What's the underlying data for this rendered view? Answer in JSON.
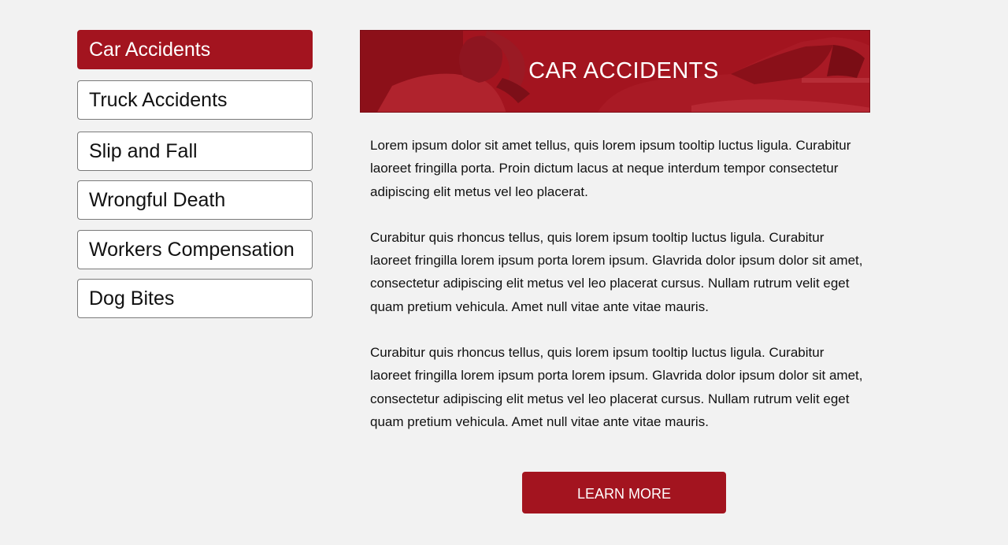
{
  "sidebar": {
    "items": [
      {
        "label": "Car Accidents",
        "active": true
      },
      {
        "label": "Truck Accidents",
        "active": false
      },
      {
        "label": "Slip and Fall",
        "active": false
      },
      {
        "label": "Wrongful Death",
        "active": false
      },
      {
        "label": "Workers Compensation",
        "active": false
      },
      {
        "label": "Dog Bites",
        "active": false
      }
    ]
  },
  "banner": {
    "title": "CAR ACCIDENTS"
  },
  "content": {
    "paragraphs": [
      "Lorem ipsum dolor sit amet tellus, quis lorem ipsum tooltip luctus ligula. Curabitur laoreet fringilla porta. Proin dictum lacus at neque interdum tempor consectetur adipiscing elit metus vel leo placerat.",
      "Curabitur quis rhoncus tellus, quis lorem ipsum tooltip luctus ligula. Curabitur laoreet fringilla lorem ipsum porta lorem ipsum. Glavrida dolor ipsum dolor sit amet, consectetur adipiscing elit metus vel leo placerat cursus. Nullam rutrum velit eget quam pretium vehicula. Amet null vitae ante vitae mauris.",
      "Curabitur quis rhoncus tellus, quis lorem ipsum tooltip luctus ligula. Curabitur laoreet fringilla lorem ipsum porta lorem ipsum. Glavrida dolor ipsum dolor sit amet, consectetur adipiscing elit metus vel leo placerat cursus. Nullam rutrum velit eget quam pretium vehicula. Amet null vitae ante vitae mauris."
    ]
  },
  "cta": {
    "label": "LEARN MORE"
  },
  "colors": {
    "accent": "#a3141f",
    "background": "#f2f2f2",
    "text": "#111111"
  }
}
